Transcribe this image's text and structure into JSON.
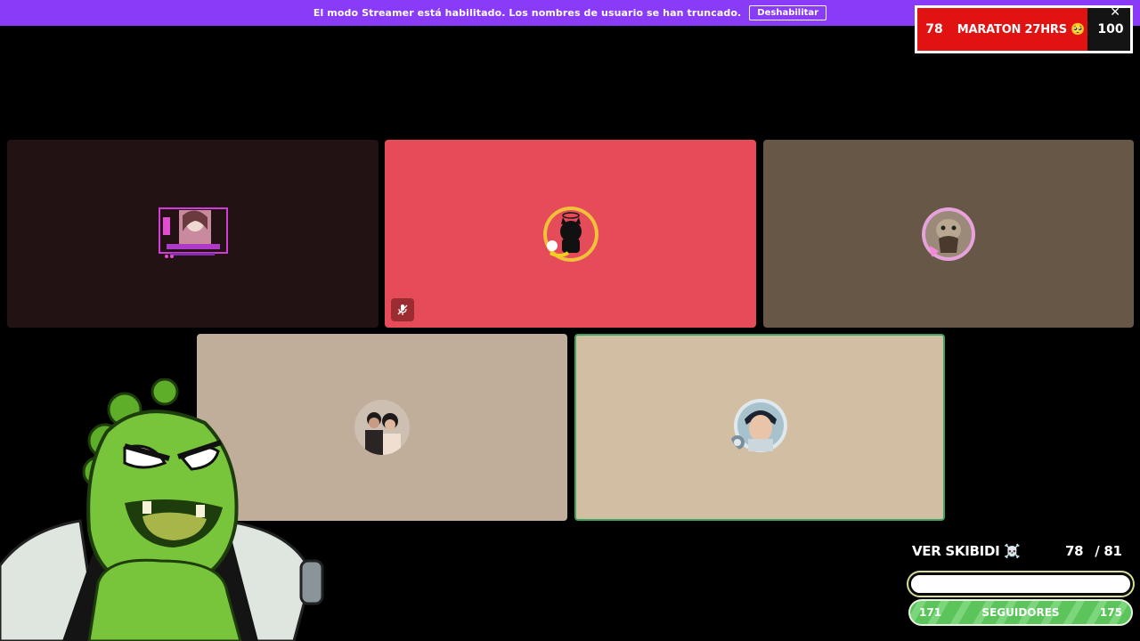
{
  "banner": {
    "text": "El modo Streamer está habilitado. Los nombres de usuario se han truncado.",
    "button_label": "Deshabilitar",
    "close_glyph": "✕",
    "color": "#8a3bf7"
  },
  "marathon": {
    "current": "78",
    "title": "MARATON 27HRS 🥺",
    "target": "100"
  },
  "tiles": [
    {
      "name": "participant-1",
      "background": "#231214",
      "avatar_icon": "neon-gamer-avatar-icon",
      "muted": false,
      "speaking": false
    },
    {
      "name": "participant-2",
      "background": "#e64b5a",
      "avatar_icon": "devil-cat-avatar-icon",
      "muted": true,
      "speaking": false
    },
    {
      "name": "participant-3",
      "background": "#675747",
      "avatar_icon": "snake-cat-avatar-icon",
      "muted": false,
      "speaking": false
    },
    {
      "name": "participant-4",
      "background": "#c0ae9a",
      "avatar_icon": "couple-photo-avatar-icon",
      "muted": false,
      "speaking": false
    },
    {
      "name": "participant-5",
      "background": "#d2bfa3",
      "avatar_icon": "anime-boy-avatar-icon",
      "muted": false,
      "speaking": true,
      "speaking_color": "#3ba55c"
    }
  ],
  "goal": {
    "label": "VER SKIBIDI ☠️",
    "current": "78",
    "total": "/ 81",
    "progress": 0.963
  },
  "followers": {
    "start": "171",
    "label": "SEGUIDORES",
    "end": "175"
  },
  "mascot": {
    "icon": "green-alien-mascot-icon"
  }
}
